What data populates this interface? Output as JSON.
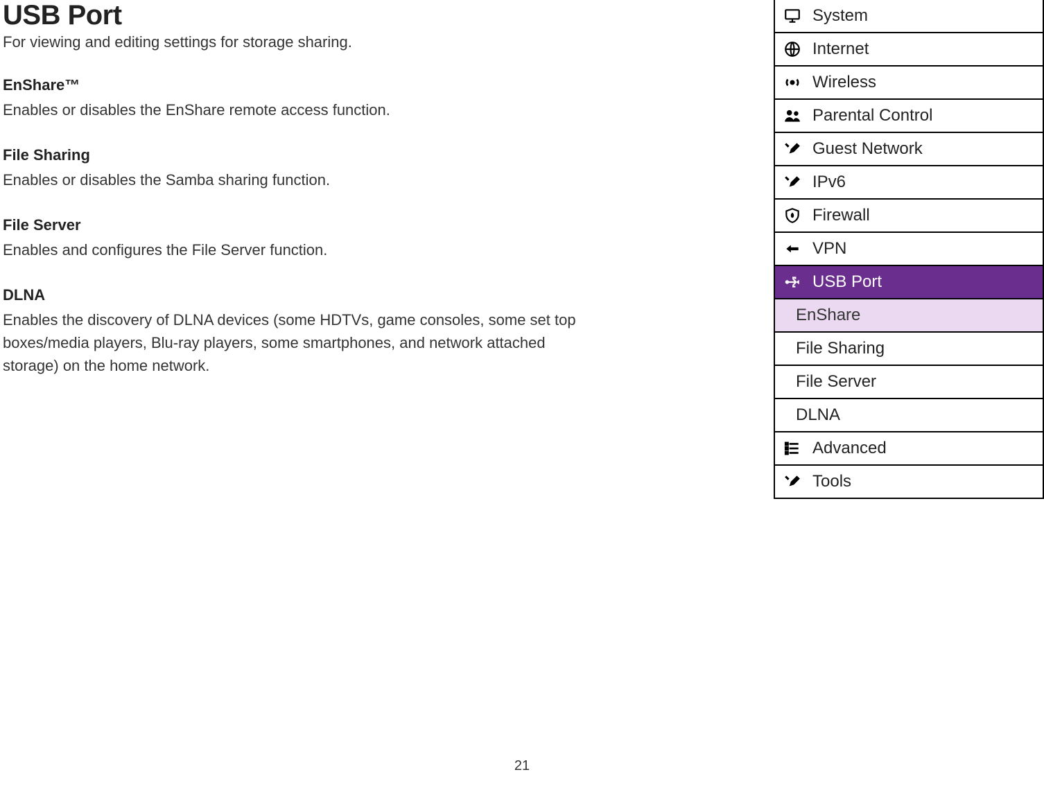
{
  "page": {
    "title": "USB Port",
    "subtitle": "For viewing and editing settings for storage sharing.",
    "page_number": "21"
  },
  "sections": [
    {
      "title": "EnShare™",
      "body": "Enables or disables the EnShare remote access function."
    },
    {
      "title": "File Sharing",
      "body": "Enables or disables the Samba sharing function."
    },
    {
      "title": "File Server",
      "body": "Enables and configures the File Server function."
    },
    {
      "title": "DLNA",
      "body": "Enables the discovery of DLNA devices (some HDTVs, game consoles, some set top boxes/media players, Blu-ray players, some smartphones, and network attached storage) on the home network."
    }
  ],
  "nav": {
    "items": [
      {
        "label": "System"
      },
      {
        "label": "Internet"
      },
      {
        "label": "Wireless"
      },
      {
        "label": "Parental Control"
      },
      {
        "label": "Guest Network"
      },
      {
        "label": "IPv6"
      },
      {
        "label": "Firewall"
      },
      {
        "label": "VPN"
      },
      {
        "label": "USB Port",
        "selected": true
      },
      {
        "label": "Advanced"
      },
      {
        "label": "Tools"
      }
    ],
    "subitems": [
      {
        "label": "EnShare",
        "active": true
      },
      {
        "label": "File Sharing"
      },
      {
        "label": "File Server"
      },
      {
        "label": "DLNA"
      }
    ]
  }
}
